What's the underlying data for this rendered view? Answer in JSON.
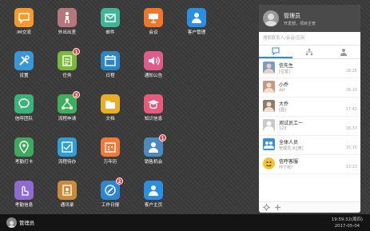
{
  "apps": [
    {
      "label": "IM交流",
      "icon": "chat-icon",
      "color": "#f59a2b"
    },
    {
      "label": "外出出差",
      "icon": "traveler-icon",
      "color": "#b5787a"
    },
    {
      "label": "邮件",
      "icon": "mail-icon",
      "color": "#3fb59a"
    },
    {
      "label": "会议",
      "icon": "meeting-icon",
      "color": "#f2752a"
    },
    {
      "label": "客户管理",
      "icon": "customer-icon",
      "color": "#2b8ee0"
    },
    {
      "label": "设置",
      "icon": "tools-icon",
      "color": "#3a96d6"
    },
    {
      "label": "任务",
      "icon": "task-icon",
      "color": "#7bb83d",
      "badge": "1"
    },
    {
      "label": "日程",
      "icon": "calendar-icon",
      "color": "#2a86c5"
    },
    {
      "label": "通知公告",
      "icon": "speaker-icon",
      "color": "#e15a8c"
    },
    {
      "label": "信呼团队",
      "icon": "team-chat-icon",
      "color": "#3bb37b"
    },
    {
      "label": "流程申请",
      "icon": "flow-icon",
      "color": "#3fae5b",
      "badge": "3"
    },
    {
      "label": "文档",
      "icon": "folder-icon",
      "color": "#e9ad28"
    },
    {
      "label": "知识信息",
      "icon": "knowledge-icon",
      "color": "#e65a7a"
    },
    {
      "label": "考勤打卡",
      "icon": "location-icon",
      "color": "#3ea85f"
    },
    {
      "label": "流程待办",
      "icon": "todo-icon",
      "color": "#2f9ed8"
    },
    {
      "label": "万年历",
      "icon": "perpetual-calendar-icon",
      "color": "#f07a3a"
    },
    {
      "label": "销售机会",
      "icon": "sales-icon",
      "color": "#4a8ac0",
      "badge": "1"
    },
    {
      "label": "考勤信息",
      "icon": "touch-icon",
      "color": "#8f6bd0"
    },
    {
      "label": "通讯录",
      "icon": "contacts-icon",
      "color": "#c98a3a"
    },
    {
      "label": "工作日报",
      "icon": "report-icon",
      "color": "#2e86d1",
      "badge": "2"
    },
    {
      "label": "客户主页",
      "icon": "customer-home-icon",
      "color": "#2b8ee0"
    }
  ],
  "panel": {
    "user_name": "管理员",
    "user_signature": "开发部，项目主管",
    "search_placeholder": "搜索联系人/会话/应用",
    "tabs": [
      {
        "icon": "chat-bubble-icon"
      },
      {
        "icon": "org-tree-icon"
      },
      {
        "icon": "person-icon"
      }
    ],
    "contacts": [
      {
        "name": "信先生",
        "msg": "[位置]",
        "time": "18:25",
        "avatar": "person-avatar",
        "color": "#7a9cc0"
      },
      {
        "name": "小乔",
        "msg": "dsf",
        "time": "18:10",
        "avatar": "person-avatar",
        "color": "#c49a85"
      },
      {
        "name": "大乔",
        "msg": "[图]",
        "time": "17:42",
        "avatar": "person-avatar",
        "color": "#8c7a6b"
      },
      {
        "name": "测试员工一",
        "msg": "123",
        "time": "16:37",
        "avatar": "default-avatar",
        "color": "#c9c9c9"
      },
      {
        "name": "全体人员",
        "msg": "管理员:大[黄]",
        "time": "15:15",
        "avatar": "group-avatar",
        "color": "#3a8fd9"
      },
      {
        "name": "信呼客服",
        "msg": "咋了呢？",
        "time": "13:23",
        "avatar": "service-avatar",
        "color": "#f4c430"
      }
    ]
  },
  "taskbar": {
    "user_name": "管理员",
    "time": "19:59:32(周四)",
    "date": "2017-05-04"
  }
}
